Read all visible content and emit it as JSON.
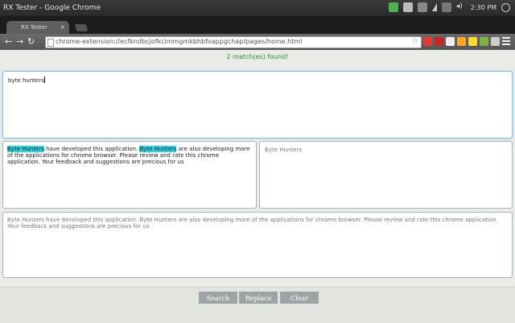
{
  "os_bar": {
    "window_title": "RX Tester - Google Chrome",
    "clock": "2:30 PM",
    "colors": {
      "green_check": "#4caf50",
      "volume": "#dddddd"
    }
  },
  "tabs": [
    {
      "label": "RX Tester",
      "close": "×"
    }
  ],
  "toolbar": {
    "back": "←",
    "forward": "→",
    "reload": "↻",
    "url": "chrome-extension://ecfkndbcjofkcimmgmkbhbfoappgchap/pages/home.html",
    "star": "☆"
  },
  "page": {
    "match_status": "2 match(es) found!",
    "regex_value": "byte hunters",
    "match_output": [
      {
        "text": "Byte Hunters",
        "highlight": true
      },
      {
        "text": " have developed this application. ",
        "highlight": false
      },
      {
        "text": "Byte Hunters",
        "highlight": true
      },
      {
        "text": " are also developing more of the applications for chrome browser. Please review and rate this chrome application. Your feedback and suggestions are precious for us",
        "highlight": false
      }
    ],
    "replace_value": "Byte Hunters",
    "source_text": "Byte Hunters have developed this application. Byte Hunters are also developing more of the applications for chrome browser. Please review and rate this chrome application. Your feedback and suggestions are precious for us",
    "buttons": {
      "search": "Search",
      "replace": "Replace",
      "clear": "Clear"
    }
  },
  "colors": {
    "highlight": "#2dd6e1",
    "status_green": "#2e8b2e",
    "button_gray": "#9ea4a6"
  }
}
